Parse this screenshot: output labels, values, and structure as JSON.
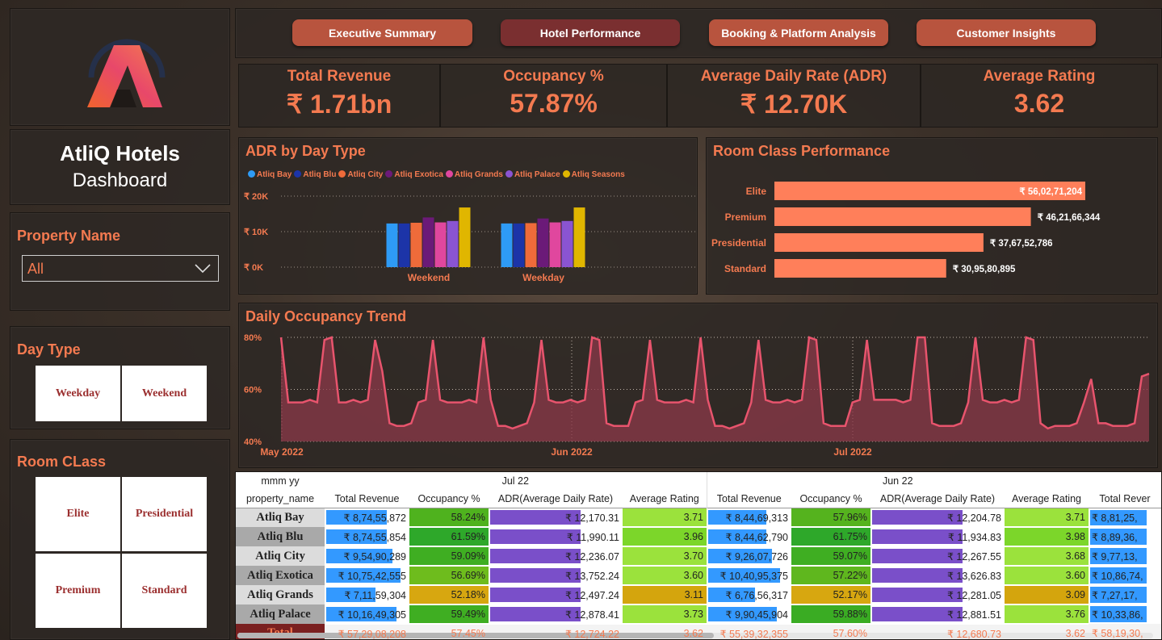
{
  "brand": {
    "name": "AtliQ Hotels",
    "subtitle": "Dashboard"
  },
  "filters": {
    "property_label": "Property Name",
    "property_value": "All",
    "day_type_label": "Day Type",
    "day_types": [
      "Weekday",
      "Weekend"
    ],
    "room_class_label": "Room CLass",
    "room_classes": [
      "Elite",
      "Presidential",
      "Premium",
      "Standard"
    ]
  },
  "nav": [
    "Executive Summary",
    "Hotel Performance",
    "Booking & Platform Analysis",
    "Customer Insights"
  ],
  "nav_active": "Hotel Performance",
  "kpis": [
    {
      "label": "Total Revenue",
      "value": "₹ 1.71bn"
    },
    {
      "label": "Occupancy %",
      "value": "57.87%"
    },
    {
      "label": "Average Daily Rate (ADR)",
      "value": "₹ 12.70K"
    },
    {
      "label": "Average Rating",
      "value": "3.62"
    }
  ],
  "colors": {
    "accent": "#f47a50",
    "bar": "#ff7f5a",
    "line": "#e8546d"
  },
  "chart_data": [
    {
      "type": "bar",
      "title": "ADR by Day Type",
      "categories": [
        "Weekend",
        "Weekday"
      ],
      "ylim": [
        0,
        20000
      ],
      "yticks": [
        "₹ 20K",
        "₹ 10K",
        "₹ 0K"
      ],
      "series": [
        {
          "name": "Atliq Bay",
          "color": "#2e9bf6",
          "values": [
            12300,
            12300
          ]
        },
        {
          "name": "Atliq Blu",
          "color": "#1c34a8",
          "values": [
            12300,
            12300
          ]
        },
        {
          "name": "Atliq City",
          "color": "#ef6b3a",
          "values": [
            12500,
            12400
          ]
        },
        {
          "name": "Atliq Exotica",
          "color": "#6b1a78",
          "values": [
            14000,
            13700
          ]
        },
        {
          "name": "Atliq Grands",
          "color": "#e0479e",
          "values": [
            12600,
            12600
          ]
        },
        {
          "name": "Atliq Palace",
          "color": "#8a54d2",
          "values": [
            13000,
            13000
          ]
        },
        {
          "name": "Atliq Seasons",
          "color": "#e0b600",
          "values": [
            16800,
            16800
          ]
        }
      ]
    },
    {
      "type": "bar",
      "title": "Room Class Performance",
      "categories": [
        "Elite",
        "Premium",
        "Presidential",
        "Standard"
      ],
      "values": [
        560271204,
        462166344,
        376752786,
        309580895
      ],
      "labels": [
        "₹ 56,02,71,204",
        "₹ 46,21,66,344",
        "₹ 37,67,52,786",
        "₹ 30,95,80,895"
      ]
    },
    {
      "type": "area",
      "title": "Daily Occupancy Trend",
      "ylim": [
        40,
        80
      ],
      "yticks": [
        "80%",
        "60%",
        "40%"
      ],
      "xticks": [
        "May 2022",
        "Jun 2022",
        "Jul 2022"
      ],
      "values": [
        80,
        55,
        55,
        55,
        56,
        55,
        79,
        80,
        55,
        55,
        56,
        55,
        56,
        79,
        67,
        47,
        46,
        46,
        47,
        55,
        56,
        79,
        56,
        55,
        55,
        55,
        56,
        55,
        80,
        56,
        46,
        46,
        45,
        46,
        47,
        55,
        79,
        56,
        55,
        55,
        56,
        55,
        56,
        80,
        79,
        47,
        46,
        46,
        46,
        55,
        56,
        79,
        56,
        55,
        55,
        55,
        56,
        55,
        80,
        56,
        46,
        46,
        45,
        46,
        47,
        55,
        79,
        56,
        55,
        55,
        56,
        55,
        56,
        80,
        79,
        47,
        46,
        46,
        46,
        55,
        56,
        79,
        56,
        56,
        56,
        56,
        55,
        56,
        80,
        80,
        47,
        46,
        46,
        46,
        47,
        55,
        80,
        56,
        55,
        55,
        56,
        55,
        56,
        80,
        79,
        47,
        45,
        46,
        46,
        46,
        47,
        55,
        64,
        47,
        47,
        46,
        46,
        46,
        47,
        65,
        66
      ]
    }
  ],
  "table": {
    "months": [
      "Jul 22",
      "Jun 22"
    ],
    "header_left": [
      "mmm yy",
      "property_name"
    ],
    "columns": [
      "Total Revenue",
      "Occupancy %",
      "ADR(Average Daily Rate)",
      "Average Rating"
    ],
    "extra_column": "Total Rever",
    "rows": [
      {
        "name": "Atliq Bay",
        "jul": [
          "₹ 8,74,55,872",
          "58.24%",
          "₹ 12,170.31",
          "3.71"
        ],
        "jun": [
          "₹ 8,44,69,313",
          "57.96%",
          "₹ 12,204.78",
          "3.71"
        ],
        "extra": "₹ 8,81,25,"
      },
      {
        "name": "Atliq Blu",
        "jul": [
          "₹ 8,74,55,854",
          "61.59%",
          "₹ 11,990.11",
          "3.96"
        ],
        "jun": [
          "₹ 8,44,62,790",
          "61.75%",
          "₹ 11,934.83",
          "3.98"
        ],
        "extra": "₹ 8,89,36,"
      },
      {
        "name": "Atliq City",
        "jul": [
          "₹ 9,54,90,289",
          "59.09%",
          "₹ 12,236.07",
          "3.70"
        ],
        "jun": [
          "₹ 9,26,07,726",
          "59.07%",
          "₹ 12,267.55",
          "3.68"
        ],
        "extra": "₹ 9,77,13,"
      },
      {
        "name": "Atliq Exotica",
        "jul": [
          "₹ 10,75,42,555",
          "56.69%",
          "₹ 13,752.24",
          "3.60"
        ],
        "jun": [
          "₹ 10,40,95,375",
          "57.22%",
          "₹ 13,626.83",
          "3.60"
        ],
        "extra": "₹ 10,86,74,"
      },
      {
        "name": "Atliq Grands",
        "jul": [
          "₹ 7,11,59,304",
          "52.18%",
          "₹ 12,497.24",
          "3.11"
        ],
        "jun": [
          "₹ 6,76,56,317",
          "52.17%",
          "₹ 12,281.05",
          "3.09"
        ],
        "extra": "₹ 7,27,17,"
      },
      {
        "name": "Atliq Palace",
        "jul": [
          "₹ 10,16,49,305",
          "59.49%",
          "₹ 12,878.41",
          "3.73"
        ],
        "jun": [
          "₹ 9,90,45,904",
          "59.88%",
          "₹ 12,881.51",
          "3.76"
        ],
        "extra": "₹ 10,33,86,"
      }
    ],
    "total": {
      "name": "Total",
      "jul": [
        "₹ 57,29,08,208",
        "57.45%",
        "₹ 12,724.22",
        "3.62"
      ],
      "jun": [
        "₹ 55,39,32,355",
        "57.60%",
        "₹ 12,680.73",
        "3.62"
      ],
      "extra": "₹ 58,19,30,"
    }
  }
}
